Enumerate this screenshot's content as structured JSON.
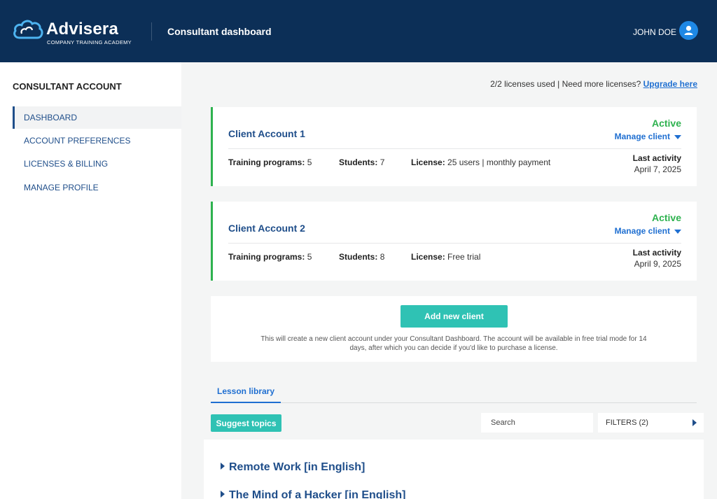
{
  "header": {
    "logo_name": "Advisera",
    "logo_sub": "COMPANY TRAINING ACADEMY",
    "title": "Consultant dashboard",
    "user_name": "JOHN DOE"
  },
  "sidebar": {
    "title": "CONSULTANT ACCOUNT",
    "items": [
      {
        "label": "DASHBOARD",
        "active": true
      },
      {
        "label": "ACCOUNT PREFERENCES",
        "active": false
      },
      {
        "label": "LICENSES & BILLING",
        "active": false
      },
      {
        "label": "MANAGE PROFILE",
        "active": false
      }
    ]
  },
  "licenses": {
    "text": "2/2 licenses used | Need more licenses?",
    "link": "Upgrade here"
  },
  "clients": [
    {
      "name": "Client Account 1",
      "status": "Active",
      "manage_label": "Manage client",
      "programs_label": "Training programs:",
      "programs": "5",
      "students_label": "Students:",
      "students": "7",
      "license_label": "License:",
      "license": "25 users | monthly payment",
      "activity_label": "Last activity",
      "activity_date": "April 7, 2025"
    },
    {
      "name": "Client Account 2",
      "status": "Active",
      "manage_label": "Manage client",
      "programs_label": "Training programs:",
      "programs": "5",
      "students_label": "Students:",
      "students": "8",
      "license_label": "License:",
      "license": "Free trial",
      "activity_label": "Last activity",
      "activity_date": "April 9, 2025"
    }
  ],
  "add_client": {
    "button": "Add new client",
    "description": "This will create a new client account under your Consultant Dashboard. The account will be available in free trial mode for 14 days, after which you can decide if you'd like to purchase a license."
  },
  "tabs": [
    {
      "label": "Lesson library"
    }
  ],
  "toolbar": {
    "suggest": "Suggest topics",
    "search_placeholder": "Search",
    "filters": "FILTERS (2)"
  },
  "lessons": [
    {
      "title": "Remote Work [in English]"
    },
    {
      "title": "The Mind of a Hacker [in English]"
    }
  ],
  "colors": {
    "header_bg": "#0c2f57",
    "accent_teal": "#2fc2b4",
    "active_green": "#2eb24f",
    "link_blue": "#1f6fd1",
    "nav_blue": "#1f4e8a"
  }
}
